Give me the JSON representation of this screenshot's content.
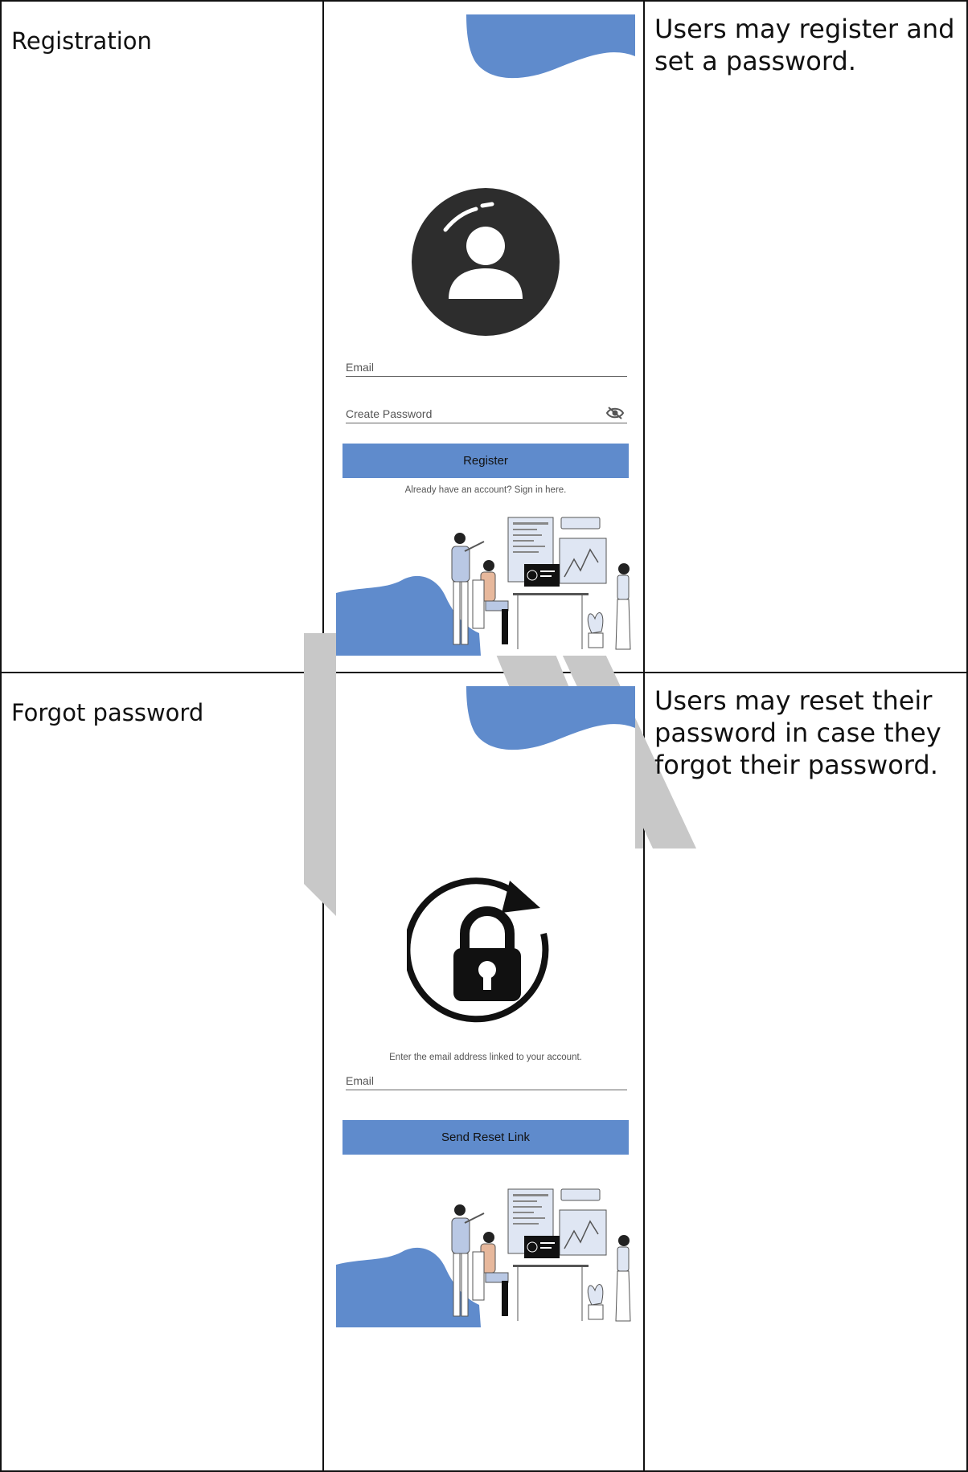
{
  "rows": [
    {
      "label": "Registration",
      "description": "Users may register and set a password.",
      "screen": {
        "email_label": "Email",
        "password_label": "Create Password",
        "button_label": "Register",
        "signin_text": "Already have an account? Sign in here."
      }
    },
    {
      "label": "Forgot password",
      "description": "Users may reset their password in case they forgot their password.",
      "screen": {
        "instruction": "Enter the email address linked to your account.",
        "email_label": "Email",
        "button_label": "Send Reset Link"
      }
    }
  ],
  "colors": {
    "accent": "#5f8bcc",
    "dark": "#2d2d2d",
    "watermark": "#c8c8c8"
  },
  "icons": [
    "user-avatar-icon",
    "eye-slash-icon",
    "lock-reset-icon"
  ]
}
